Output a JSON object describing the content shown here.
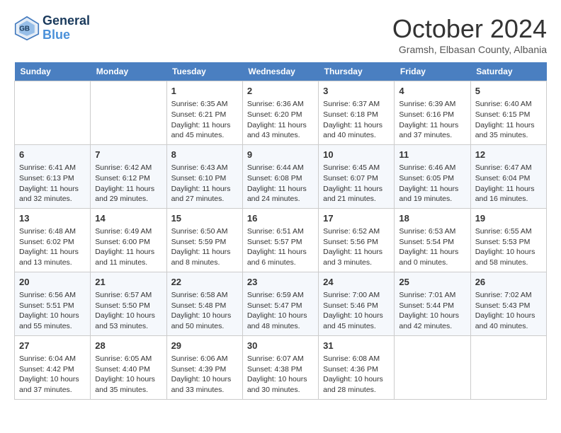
{
  "header": {
    "logo_line1": "General",
    "logo_line2": "Blue",
    "month": "October 2024",
    "location": "Gramsh, Elbasan County, Albania"
  },
  "days_of_week": [
    "Sunday",
    "Monday",
    "Tuesday",
    "Wednesday",
    "Thursday",
    "Friday",
    "Saturday"
  ],
  "weeks": [
    [
      {
        "day": "",
        "sunrise": "",
        "sunset": "",
        "daylight": ""
      },
      {
        "day": "",
        "sunrise": "",
        "sunset": "",
        "daylight": ""
      },
      {
        "day": "1",
        "sunrise": "Sunrise: 6:35 AM",
        "sunset": "Sunset: 6:21 PM",
        "daylight": "Daylight: 11 hours and 45 minutes."
      },
      {
        "day": "2",
        "sunrise": "Sunrise: 6:36 AM",
        "sunset": "Sunset: 6:20 PM",
        "daylight": "Daylight: 11 hours and 43 minutes."
      },
      {
        "day": "3",
        "sunrise": "Sunrise: 6:37 AM",
        "sunset": "Sunset: 6:18 PM",
        "daylight": "Daylight: 11 hours and 40 minutes."
      },
      {
        "day": "4",
        "sunrise": "Sunrise: 6:39 AM",
        "sunset": "Sunset: 6:16 PM",
        "daylight": "Daylight: 11 hours and 37 minutes."
      },
      {
        "day": "5",
        "sunrise": "Sunrise: 6:40 AM",
        "sunset": "Sunset: 6:15 PM",
        "daylight": "Daylight: 11 hours and 35 minutes."
      }
    ],
    [
      {
        "day": "6",
        "sunrise": "Sunrise: 6:41 AM",
        "sunset": "Sunset: 6:13 PM",
        "daylight": "Daylight: 11 hours and 32 minutes."
      },
      {
        "day": "7",
        "sunrise": "Sunrise: 6:42 AM",
        "sunset": "Sunset: 6:12 PM",
        "daylight": "Daylight: 11 hours and 29 minutes."
      },
      {
        "day": "8",
        "sunrise": "Sunrise: 6:43 AM",
        "sunset": "Sunset: 6:10 PM",
        "daylight": "Daylight: 11 hours and 27 minutes."
      },
      {
        "day": "9",
        "sunrise": "Sunrise: 6:44 AM",
        "sunset": "Sunset: 6:08 PM",
        "daylight": "Daylight: 11 hours and 24 minutes."
      },
      {
        "day": "10",
        "sunrise": "Sunrise: 6:45 AM",
        "sunset": "Sunset: 6:07 PM",
        "daylight": "Daylight: 11 hours and 21 minutes."
      },
      {
        "day": "11",
        "sunrise": "Sunrise: 6:46 AM",
        "sunset": "Sunset: 6:05 PM",
        "daylight": "Daylight: 11 hours and 19 minutes."
      },
      {
        "day": "12",
        "sunrise": "Sunrise: 6:47 AM",
        "sunset": "Sunset: 6:04 PM",
        "daylight": "Daylight: 11 hours and 16 minutes."
      }
    ],
    [
      {
        "day": "13",
        "sunrise": "Sunrise: 6:48 AM",
        "sunset": "Sunset: 6:02 PM",
        "daylight": "Daylight: 11 hours and 13 minutes."
      },
      {
        "day": "14",
        "sunrise": "Sunrise: 6:49 AM",
        "sunset": "Sunset: 6:00 PM",
        "daylight": "Daylight: 11 hours and 11 minutes."
      },
      {
        "day": "15",
        "sunrise": "Sunrise: 6:50 AM",
        "sunset": "Sunset: 5:59 PM",
        "daylight": "Daylight: 11 hours and 8 minutes."
      },
      {
        "day": "16",
        "sunrise": "Sunrise: 6:51 AM",
        "sunset": "Sunset: 5:57 PM",
        "daylight": "Daylight: 11 hours and 6 minutes."
      },
      {
        "day": "17",
        "sunrise": "Sunrise: 6:52 AM",
        "sunset": "Sunset: 5:56 PM",
        "daylight": "Daylight: 11 hours and 3 minutes."
      },
      {
        "day": "18",
        "sunrise": "Sunrise: 6:53 AM",
        "sunset": "Sunset: 5:54 PM",
        "daylight": "Daylight: 11 hours and 0 minutes."
      },
      {
        "day": "19",
        "sunrise": "Sunrise: 6:55 AM",
        "sunset": "Sunset: 5:53 PM",
        "daylight": "Daylight: 10 hours and 58 minutes."
      }
    ],
    [
      {
        "day": "20",
        "sunrise": "Sunrise: 6:56 AM",
        "sunset": "Sunset: 5:51 PM",
        "daylight": "Daylight: 10 hours and 55 minutes."
      },
      {
        "day": "21",
        "sunrise": "Sunrise: 6:57 AM",
        "sunset": "Sunset: 5:50 PM",
        "daylight": "Daylight: 10 hours and 53 minutes."
      },
      {
        "day": "22",
        "sunrise": "Sunrise: 6:58 AM",
        "sunset": "Sunset: 5:48 PM",
        "daylight": "Daylight: 10 hours and 50 minutes."
      },
      {
        "day": "23",
        "sunrise": "Sunrise: 6:59 AM",
        "sunset": "Sunset: 5:47 PM",
        "daylight": "Daylight: 10 hours and 48 minutes."
      },
      {
        "day": "24",
        "sunrise": "Sunrise: 7:00 AM",
        "sunset": "Sunset: 5:46 PM",
        "daylight": "Daylight: 10 hours and 45 minutes."
      },
      {
        "day": "25",
        "sunrise": "Sunrise: 7:01 AM",
        "sunset": "Sunset: 5:44 PM",
        "daylight": "Daylight: 10 hours and 42 minutes."
      },
      {
        "day": "26",
        "sunrise": "Sunrise: 7:02 AM",
        "sunset": "Sunset: 5:43 PM",
        "daylight": "Daylight: 10 hours and 40 minutes."
      }
    ],
    [
      {
        "day": "27",
        "sunrise": "Sunrise: 6:04 AM",
        "sunset": "Sunset: 4:42 PM",
        "daylight": "Daylight: 10 hours and 37 minutes."
      },
      {
        "day": "28",
        "sunrise": "Sunrise: 6:05 AM",
        "sunset": "Sunset: 4:40 PM",
        "daylight": "Daylight: 10 hours and 35 minutes."
      },
      {
        "day": "29",
        "sunrise": "Sunrise: 6:06 AM",
        "sunset": "Sunset: 4:39 PM",
        "daylight": "Daylight: 10 hours and 33 minutes."
      },
      {
        "day": "30",
        "sunrise": "Sunrise: 6:07 AM",
        "sunset": "Sunset: 4:38 PM",
        "daylight": "Daylight: 10 hours and 30 minutes."
      },
      {
        "day": "31",
        "sunrise": "Sunrise: 6:08 AM",
        "sunset": "Sunset: 4:36 PM",
        "daylight": "Daylight: 10 hours and 28 minutes."
      },
      {
        "day": "",
        "sunrise": "",
        "sunset": "",
        "daylight": ""
      },
      {
        "day": "",
        "sunrise": "",
        "sunset": "",
        "daylight": ""
      }
    ]
  ]
}
